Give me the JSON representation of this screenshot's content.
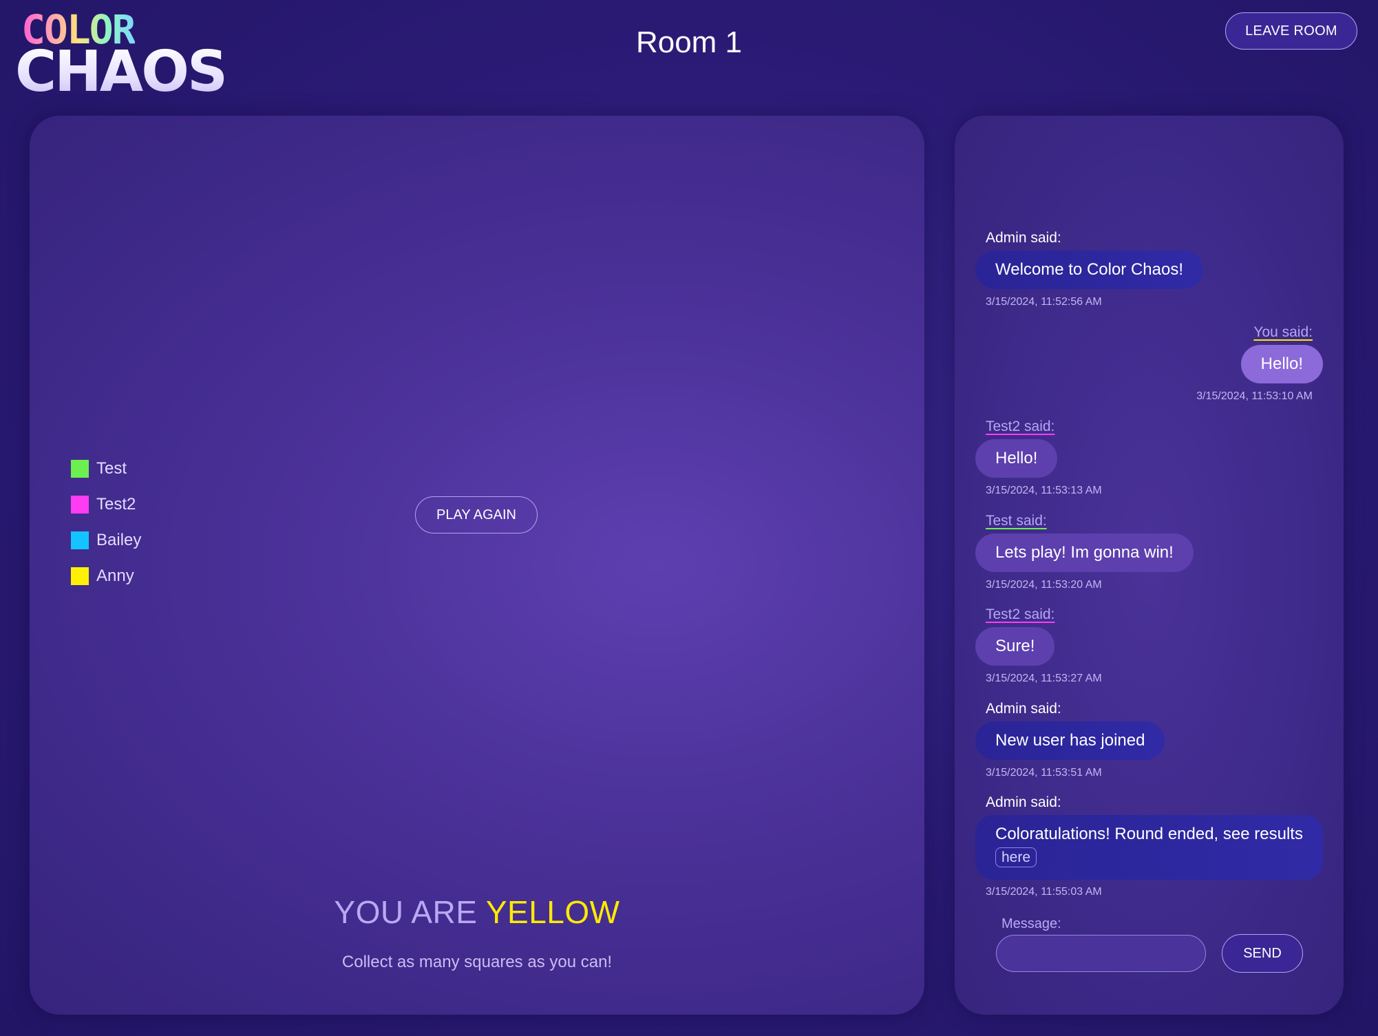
{
  "header": {
    "logo_top": "COLOR",
    "logo_bottom": "CHAOS",
    "room_title": "Room 1",
    "leave_label": "LEAVE ROOM"
  },
  "game": {
    "players": [
      {
        "name": "Test",
        "color": "#6cf04f"
      },
      {
        "name": "Test2",
        "color": "#ff3cf2"
      },
      {
        "name": "Bailey",
        "color": "#14c4ff"
      },
      {
        "name": "Anny",
        "color": "#fff200"
      }
    ],
    "play_again_label": "PLAY AGAIN",
    "you_are_prefix": "YOU ARE",
    "you_are_color": "YELLOW",
    "instruction": "Collect as many squares as you can!"
  },
  "chat": {
    "messages": [
      {
        "sender": "Admin said:",
        "text": "Welcome to Color Chaos!",
        "time": "3/15/2024, 11:52:56 AM"
      },
      {
        "sender": "You said:",
        "text": "Hello!",
        "time": "3/15/2024, 11:53:10 AM"
      },
      {
        "sender": "Test2 said:",
        "text": "Hello!",
        "time": "3/15/2024, 11:53:13 AM"
      },
      {
        "sender": "Test said:",
        "text": "Lets play! Im gonna win!",
        "time": "3/15/2024, 11:53:20 AM"
      },
      {
        "sender": "Test2 said:",
        "text": "Sure!",
        "time": "3/15/2024, 11:53:27 AM"
      },
      {
        "sender": "Admin said:",
        "text": "New user has joined",
        "time": "3/15/2024, 11:53:51 AM"
      },
      {
        "sender": "Admin said:",
        "text": "Coloratulations! Round ended, see results",
        "link": "here",
        "time": "3/15/2024, 11:55:03 AM"
      }
    ],
    "message_label": "Message:",
    "message_value": "",
    "send_label": "SEND"
  },
  "colors": {
    "background": "#26166a",
    "accent": "#8d6ad9",
    "highlight": "#ffea00",
    "test2_underline": "#ff3cf2",
    "test_underline": "#6cf04f",
    "you_underline": "#ffea00"
  }
}
